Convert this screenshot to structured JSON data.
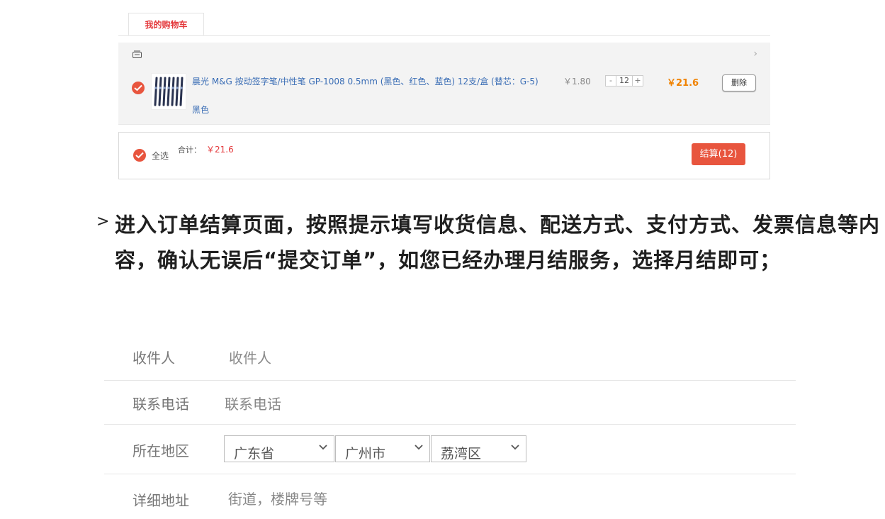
{
  "cart": {
    "tab_label": "我的购物车",
    "item": {
      "title": "晨光 M&G 按动签字笔/中性笔 GP-1008 0.5mm (黑色、红色、蓝色) 12支/盒 (替芯：G-5)",
      "color": "黑色",
      "unit_price": "￥1.80",
      "qty_minus": "-",
      "quantity": "12",
      "qty_plus": "+",
      "line_total": "￥21.6",
      "delete_label": "删除"
    },
    "summary": {
      "select_all_label": "全选",
      "total_label": "合计：",
      "total_value": "￥21.6",
      "checkout_label": "结算(12)"
    }
  },
  "instruction": {
    "bullet": ">",
    "text": "进入订单结算页面，按照提示填写收货信息、配送方式、支付方式、发票信息等内容，确认无误后“提交订单”，如您已经办理月结服务，选择月结即可；"
  },
  "form": {
    "recipient": {
      "label": "收件人",
      "placeholder": "收件人"
    },
    "phone": {
      "label": "联系电话",
      "placeholder": "联系电话"
    },
    "region": {
      "label": "所在地区",
      "province": "广东省",
      "city": "广州市",
      "district": "荔湾区"
    },
    "address": {
      "label": "详细地址",
      "placeholder": "街道，楼牌号等"
    }
  },
  "colors": {
    "accent": "#e8553e",
    "price_orange": "#f08200",
    "link_blue": "#3a6db5"
  }
}
